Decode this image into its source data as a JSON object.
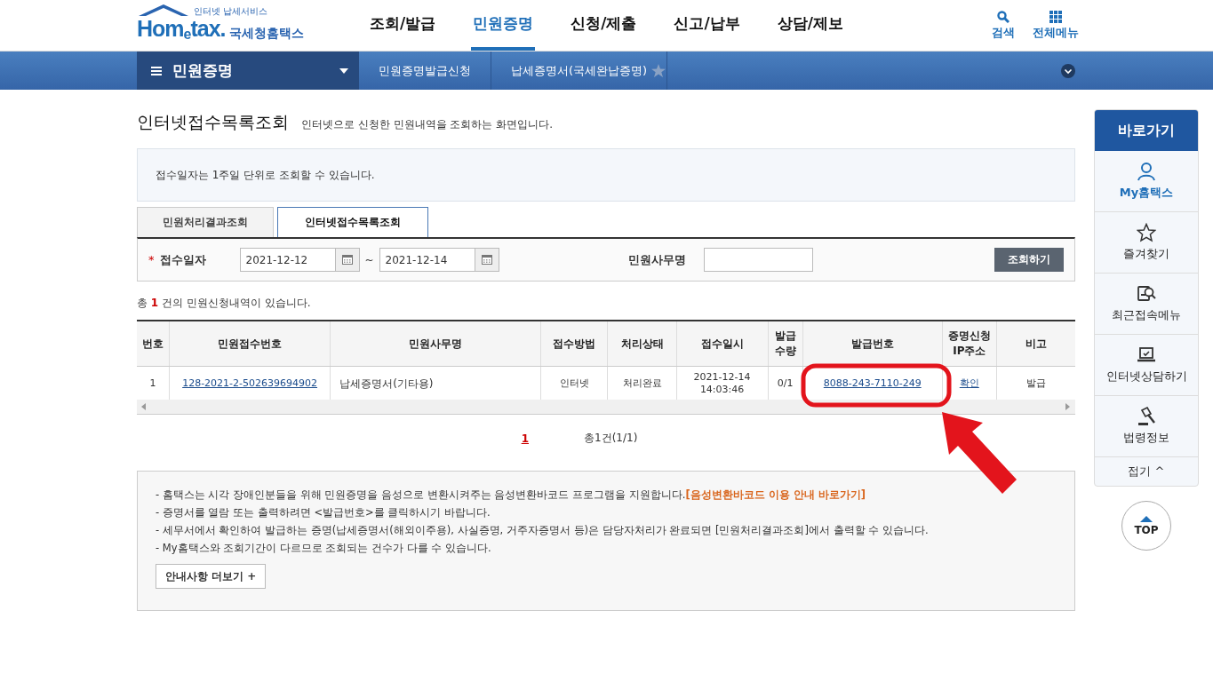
{
  "header": {
    "logo": {
      "tagline": "인터넷 납세서비스",
      "wordmark": "Hom$_{e}$tax.",
      "name": "국세청홈택스"
    },
    "nav": [
      {
        "label": "조회/발급",
        "selected": false
      },
      {
        "label": "민원증명",
        "selected": true
      },
      {
        "label": "신청/제출",
        "selected": false
      },
      {
        "label": "신고/납부",
        "selected": false
      },
      {
        "label": "상담/제보",
        "selected": false
      }
    ],
    "tools": [
      {
        "kind": "search",
        "label": "검색"
      },
      {
        "kind": "grid",
        "label": "전체메뉴"
      }
    ]
  },
  "breadcrumb": {
    "menu": "민원증명",
    "items": [
      "민원증명발급신청",
      "납세증명서(국세완납증명)"
    ],
    "favorite": false
  },
  "page": {
    "title": "인터넷접수목록조회",
    "subtitle": "인터넷으로 신청한 민원내역을 조회하는 화면입니다.",
    "notice": "접수일자는 1주일 단위로 조회할 수 있습니다.",
    "tabs": [
      {
        "label": "민원처리결과조회",
        "selected": false
      },
      {
        "label": "인터넷접수목록조회",
        "selected": true
      }
    ],
    "search": {
      "required_mark": "*",
      "date_label": "접수일자",
      "date_from": "2021-12-12",
      "date_sep": "~",
      "date_to": "2021-12-14",
      "name_label": "민원사무명",
      "button": "조회하기"
    },
    "summary": {
      "before": "총",
      "count": "1",
      "after": "건의 민원신청내역이 있습니다."
    },
    "table": {
      "columns": [
        "번호",
        "민원접수번호",
        "민원사무명",
        "접수방법",
        "처리상태",
        "접수일시",
        "발급 수량",
        "발급번호",
        "증명신청 IP주소",
        "비고"
      ],
      "rows": [
        {
          "cells": [
            {
              "text": "1",
              "kind": "text"
            },
            {
              "text": "128-2021-2-502639694902",
              "kind": "link"
            },
            {
              "text": "납세증명서(기타용)",
              "kind": "left"
            },
            {
              "text": "인터넷",
              "kind": "text"
            },
            {
              "text": "처리완료",
              "kind": "text"
            },
            {
              "text": "2021-12-14 14:03:46",
              "kind": "text"
            },
            {
              "text": "0/1",
              "kind": "text"
            },
            {
              "text": "8088-243-7110-249",
              "kind": "link"
            },
            {
              "text": "확인",
              "kind": "link"
            },
            {
              "text": "발급",
              "kind": "text"
            }
          ]
        }
      ]
    },
    "pagination": {
      "pages": [
        {
          "label": "1",
          "selected": true
        }
      ],
      "total": "총1건(1/1)"
    },
    "guide": {
      "lines": [
        {
          "text": "- 홈택스는 시각 장애인분들을 위해 민원증명을 음성으로 변환시켜주는 음성변환바코드 프로그램을 지원합니다.",
          "link": "[음성변환바코드 이용 안내 바로가기]"
        },
        {
          "text": "- 증명서를 열람 또는 출력하려면 <발급번호>를 클릭하시기 바랍니다."
        },
        {
          "text": "- 세무서에서 확인하여 발급하는 증명(납세증명서(해외이주용), 사실증명, 거주자증명서 등)은 담당자처리가 완료되면 [민원처리결과조회]에서 출력할 수 있습니다."
        },
        {
          "text": "- My홈택스와 조회기간이 다르므로 조회되는 건수가 다를 수 있습니다."
        }
      ],
      "more": "안내사항 더보기 +"
    }
  },
  "quick": {
    "title": "바로가기",
    "items": [
      {
        "kind": "person",
        "label": "My홈택스",
        "selected": true
      },
      {
        "kind": "star",
        "label": "즐겨찾기",
        "selected": false
      },
      {
        "kind": "docsearch",
        "label": "최근접속메뉴",
        "selected": false
      },
      {
        "kind": "laptop",
        "label": "인터넷상담하기",
        "selected": false
      },
      {
        "kind": "gavel",
        "label": "법령정보",
        "selected": false
      }
    ],
    "fold": "접기 ^",
    "top": "TOP"
  },
  "annotation": {
    "highlight": true,
    "arrow": true
  }
}
